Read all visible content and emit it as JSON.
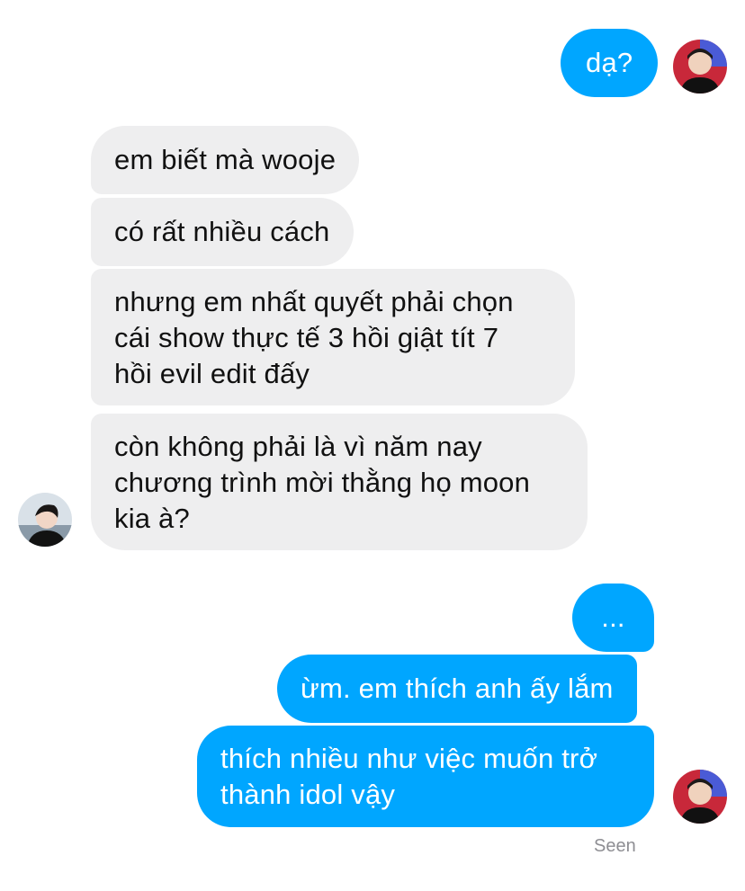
{
  "messages": [
    {
      "id": "m1",
      "side": "outgoing",
      "text": "dạ?"
    },
    {
      "id": "m2",
      "side": "incoming",
      "text": "em biết mà wooje"
    },
    {
      "id": "m3",
      "side": "incoming",
      "text": "có rất nhiều cách"
    },
    {
      "id": "m4",
      "side": "incoming",
      "lines": [
        "nhưng em nhất quyết phải chọn",
        "cái show thực tế 3 hồi giật tít 7",
        "hồi evil edit đấy"
      ]
    },
    {
      "id": "m5",
      "side": "incoming",
      "lines": [
        "còn không phải là vì năm nay",
        "chương trình mời thằng họ moon",
        "kia à?"
      ]
    },
    {
      "id": "m6",
      "side": "outgoing",
      "text": "..."
    },
    {
      "id": "m7",
      "side": "outgoing",
      "text": "ừm. em thích anh ấy lắm"
    },
    {
      "id": "m8",
      "side": "outgoing",
      "lines": [
        "thích nhiều như việc muốn trở",
        "thành idol vậy"
      ]
    }
  ],
  "status": {
    "seen": "Seen"
  },
  "avatars": {
    "self": "user-avatar",
    "contact": "contact-avatar"
  },
  "colors": {
    "outgoing": "#00a6ff",
    "incoming": "#eeeeef",
    "seen": "#8e8e93"
  }
}
